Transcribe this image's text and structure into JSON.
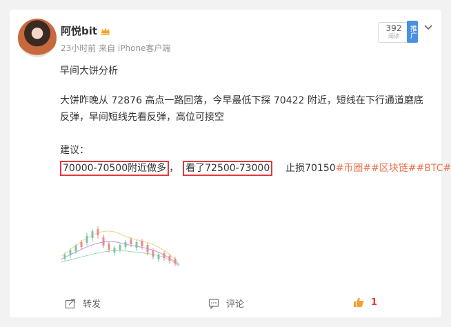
{
  "user": {
    "name": "阿悦bit"
  },
  "post": {
    "meta": "23小时前 来自 iPhone客户端",
    "title": "早间大饼分析",
    "body": "大饼昨晚从 72876 高点一路回落，今早最低下探 70422 附近，短线在下行通道磨底反弹，早间短线先看反弹，高位可接空",
    "advice_label": "建议：",
    "advice_long": "70000-70500附近做多",
    "advice_sep": "，",
    "advice_short": "看了72500-73000",
    "advice_rest": "  止损70150",
    "tags": [
      "#币圈#",
      "#区块链#",
      "#BTC#"
    ]
  },
  "views": {
    "count": "392",
    "label": "阅读"
  },
  "promote": {
    "label": "推广"
  },
  "actions": {
    "repost": "转发",
    "comment": "评论",
    "like_count": "1"
  },
  "icons": [
    "crown-icon",
    "chevron-down-icon",
    "repost-icon",
    "comment-icon",
    "thumbs-up-icon"
  ]
}
